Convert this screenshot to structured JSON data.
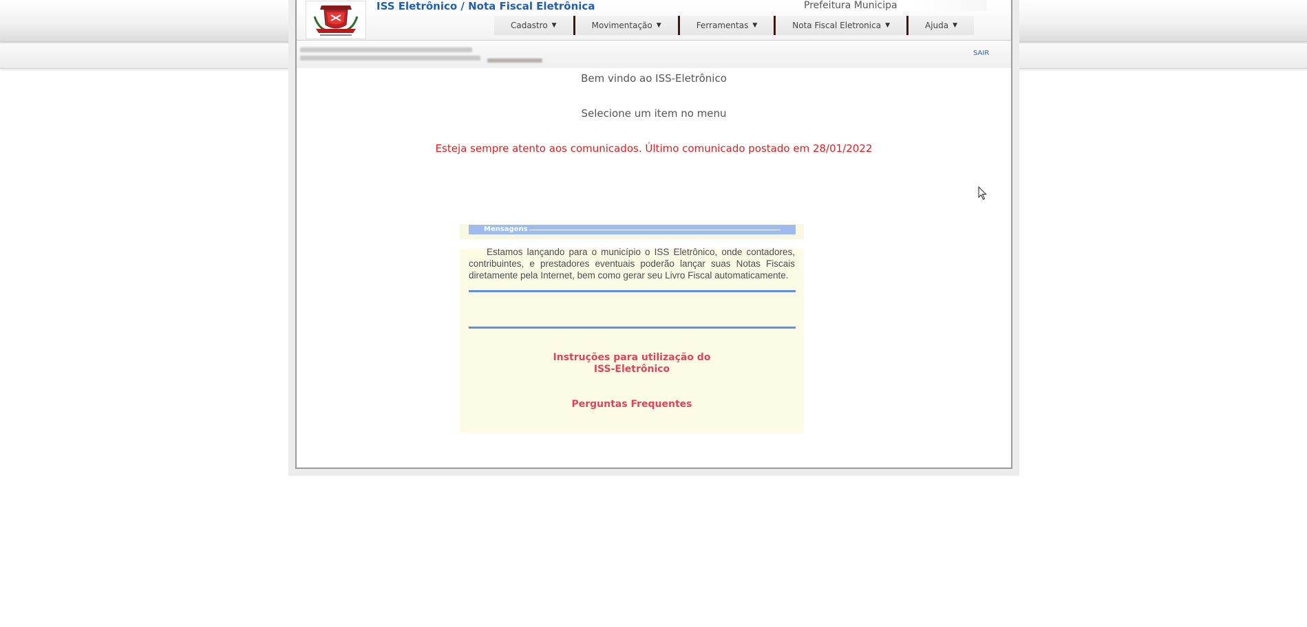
{
  "header": {
    "app_title": "ISS Eletrônico / Nota Fiscal Eletrônica",
    "prefeitura": "Prefeitura Municipa",
    "logo_icon": "municipal-coat-of-arms-icon"
  },
  "menu": {
    "items": [
      {
        "label": "Cadastro"
      },
      {
        "label": "Movimentação"
      },
      {
        "label": "Ferramentas"
      },
      {
        "label": "Nota Fiscal Eletronica"
      },
      {
        "label": "Ajuda"
      }
    ],
    "caret": "▼"
  },
  "subbar": {
    "logout_label": "SAIR"
  },
  "main": {
    "welcome": "Bem vindo ao ISS-Eletrônico",
    "select_prompt": "Selecione um item no menu",
    "notice": "Esteja sempre atento aos comunicados. Último comunicado postado em 28/01/2022"
  },
  "messages": {
    "legend": "Mensagens",
    "body": "Estamos lançando para o município o ISS Eletrônico, onde contadores, contribuintes, e prestadores eventuais poderão lançar suas Notas Fiscais diretamente pela Internet, bem como gerar seu Livro Fiscal automaticamente.",
    "instructions_line1": "Instruções para utilização do",
    "instructions_line2": "ISS-Eletrônico",
    "faq": "Perguntas Frequentes"
  },
  "colors": {
    "title_blue": "#1f5fb0",
    "notice_red": "#e01e1e",
    "link_red": "#e3435a",
    "rule_blue": "#5f8ee6",
    "legend_blue": "#9ebbf0",
    "panel_cream": "#fbfbe6"
  }
}
